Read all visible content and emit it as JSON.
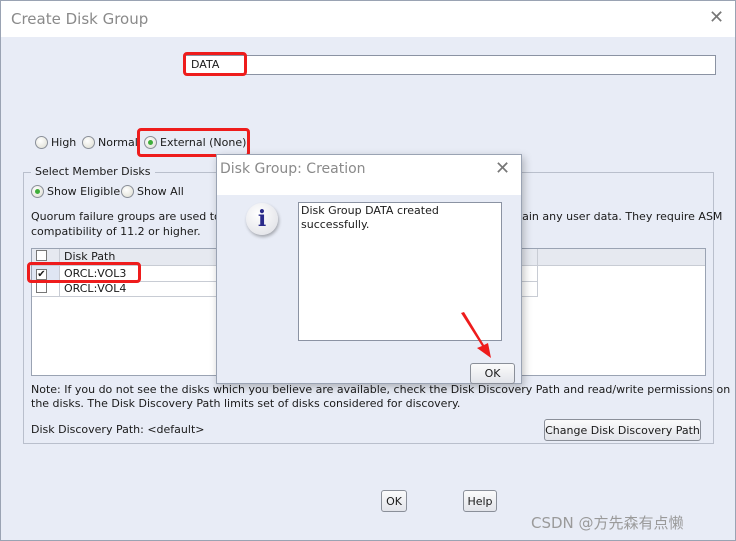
{
  "window": {
    "title": "Create Disk Group",
    "close_icon": "close-icon"
  },
  "disk_group_name": "DATA",
  "redundancy": {
    "options": [
      {
        "label": "High",
        "selected": false
      },
      {
        "label": "Normal",
        "selected": false
      },
      {
        "label": "External (None)",
        "selected": true
      }
    ]
  },
  "member_disks": {
    "legend": "Select Member Disks",
    "filter": [
      {
        "label": "Show Eligible",
        "selected": true
      },
      {
        "label": "Show All",
        "selected": false
      }
    ],
    "quorum_note_line1": "Quorum failure groups are used to store voting files in extended clusters and do not contain any user data. They require ASM",
    "quorum_note_line2": "compatibility of 11.2 or higher.",
    "table": {
      "columns": [
        "",
        "Disk Path"
      ],
      "rows": [
        {
          "checked": true,
          "path": "ORCL:VOL3"
        },
        {
          "checked": false,
          "path": "ORCL:VOL4"
        }
      ]
    },
    "note_line1": "Note: If you do not see the disks which you believe are available, check the Disk Discovery Path and read/write permissions on",
    "note_line2": "the disks. The Disk Discovery Path limits set of disks considered for discovery.",
    "discovery_path": "Disk Discovery Path: <default>",
    "change_path_button": "Change Disk Discovery Path"
  },
  "buttons": {
    "ok": "OK",
    "help": "Help"
  },
  "dialog": {
    "title": "Disk Group: Creation",
    "icon": "info-icon",
    "message": "Disk Group DATA created successfully.",
    "ok": "OK"
  },
  "watermark": "CSDN @方先森有点懒",
  "colors": {
    "highlight": "#ee1c1c",
    "radio_selected": "#3fae3a"
  }
}
